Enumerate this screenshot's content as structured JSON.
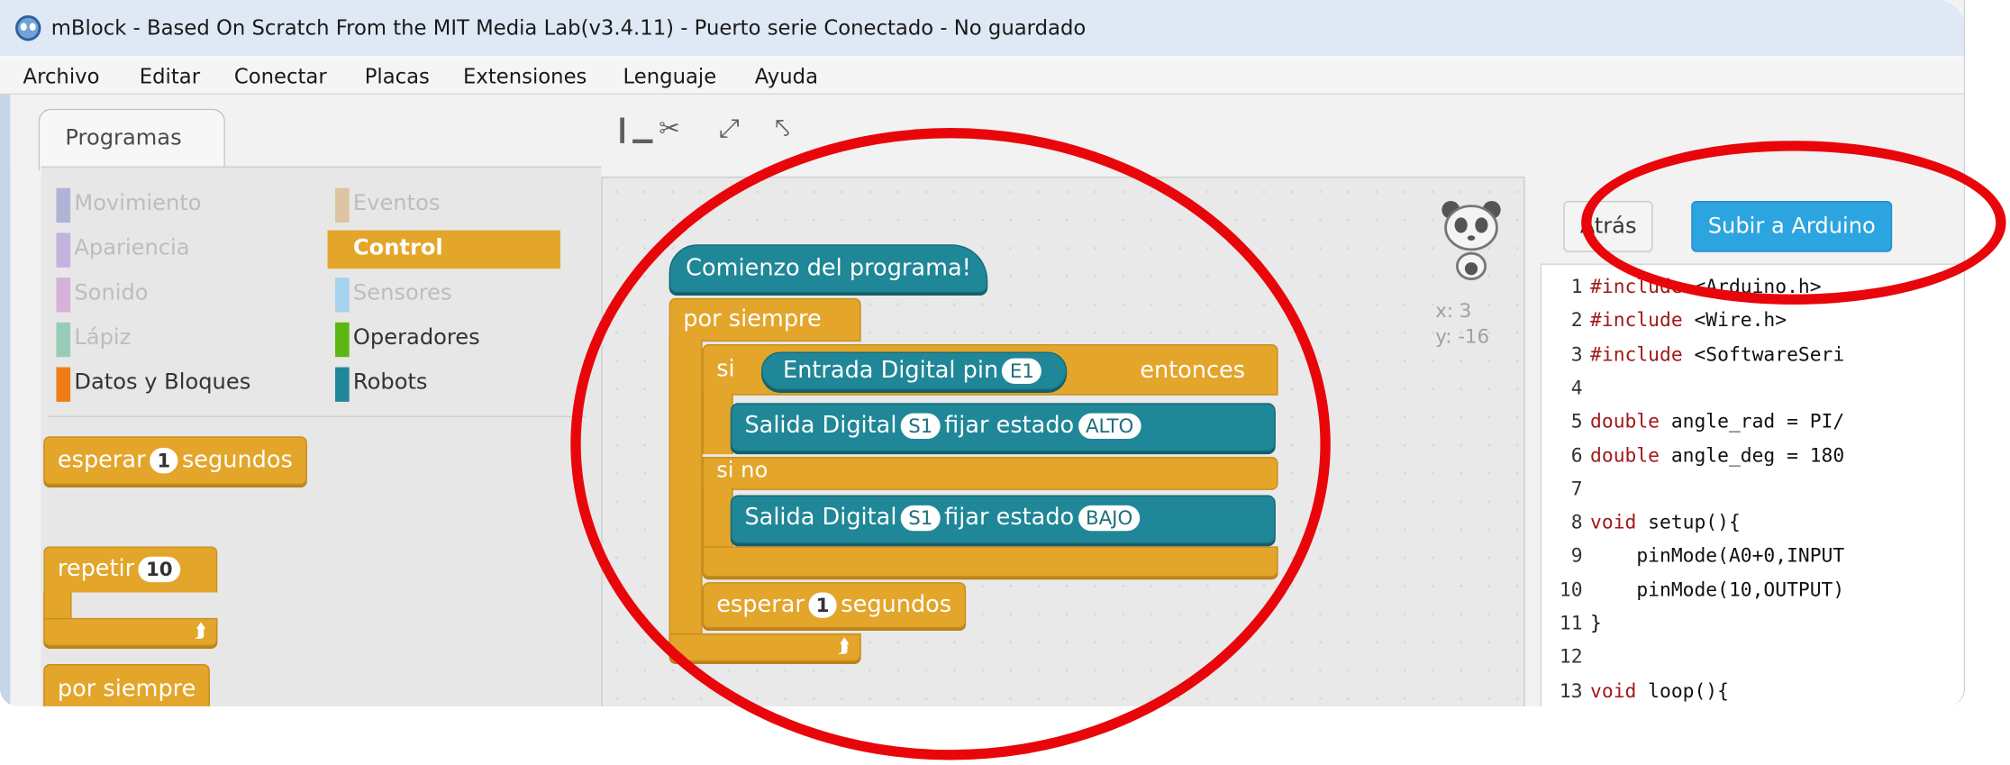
{
  "window": {
    "title": "mBlock - Based On Scratch From the MIT Media Lab(v3.4.11) - Puerto serie Conectado - No guardado"
  },
  "menubar": {
    "items": [
      "Archivo",
      "Editar",
      "Conectar",
      "Placas",
      "Extensiones",
      "Lenguaje",
      "Ayuda"
    ]
  },
  "tabs": {
    "programs": "Programas"
  },
  "toolbar": {
    "icons": [
      "stamp-icon",
      "cut-icon",
      "grow-icon",
      "shrink-icon"
    ]
  },
  "categories": [
    {
      "label": "Movimiento",
      "color": "#4a6cd4"
    },
    {
      "label": "Apariencia",
      "color": "#8a55d7"
    },
    {
      "label": "Sonido",
      "color": "#bb42c3"
    },
    {
      "label": "Lápiz",
      "color": "#0e9a6c"
    },
    {
      "label": "Datos y Bloques",
      "color": "#ee7d16"
    },
    {
      "label": "Eventos",
      "color": "#c88330"
    },
    {
      "label": "Control",
      "color": "#e3a52a"
    },
    {
      "label": "Sensores",
      "color": "#2ca5e2"
    },
    {
      "label": "Operadores",
      "color": "#5cb712"
    },
    {
      "label": "Robots",
      "color": "#1f8797"
    }
  ],
  "palette": {
    "wait": {
      "label": "esperar",
      "value": "1",
      "unit": "segundos"
    },
    "repeat": {
      "label": "repetir",
      "value": "10"
    },
    "forever": {
      "label": "por siempre"
    }
  },
  "script": {
    "hat": "Comienzo del programa!",
    "forever": "por siempre",
    "if_label": "si",
    "condition": {
      "label": "Entrada Digital pin",
      "pin": "E1"
    },
    "then_label": "entonces",
    "out1": {
      "label": "Salida Digital",
      "pin": "S1",
      "state_label": "fijar estado",
      "state": "ALTO"
    },
    "else_label": "si no",
    "out2": {
      "label": "Salida Digital",
      "pin": "S1",
      "state_label": "fijar estado",
      "state": "BAJO"
    },
    "wait": {
      "label": "esperar",
      "value": "1",
      "unit": "segundos"
    }
  },
  "sprite": {
    "x_label": "x: 3",
    "y_label": "y: -16"
  },
  "code_panel": {
    "back_button": "Atrás",
    "upload_button": "Subir a Arduino",
    "lines": [
      {
        "n": "1",
        "pre": "#include",
        "rest": " <Arduino.h>"
      },
      {
        "n": "2",
        "pre": "#include",
        "rest": " <Wire.h>"
      },
      {
        "n": "3",
        "pre": "#include",
        "rest": " <SoftwareSeri"
      },
      {
        "n": "4",
        "pre": "",
        "rest": ""
      },
      {
        "n": "5",
        "pre": "double",
        "rest": " angle_rad = PI/"
      },
      {
        "n": "6",
        "pre": "double",
        "rest": " angle_deg = 180"
      },
      {
        "n": "7",
        "pre": "",
        "rest": ""
      },
      {
        "n": "8",
        "pre": "void",
        "rest": " setup(){"
      },
      {
        "n": "9",
        "pre": "",
        "rest": "    pinMode(A0+0,INPUT"
      },
      {
        "n": "10",
        "pre": "",
        "rest": "    pinMode(10,OUTPUT)"
      },
      {
        "n": "11",
        "pre": "",
        "rest": "}"
      },
      {
        "n": "12",
        "pre": "",
        "rest": ""
      },
      {
        "n": "13",
        "pre": "void",
        "rest": " loop(){"
      }
    ]
  },
  "annotations": {
    "ring_color": "#e8060b"
  }
}
